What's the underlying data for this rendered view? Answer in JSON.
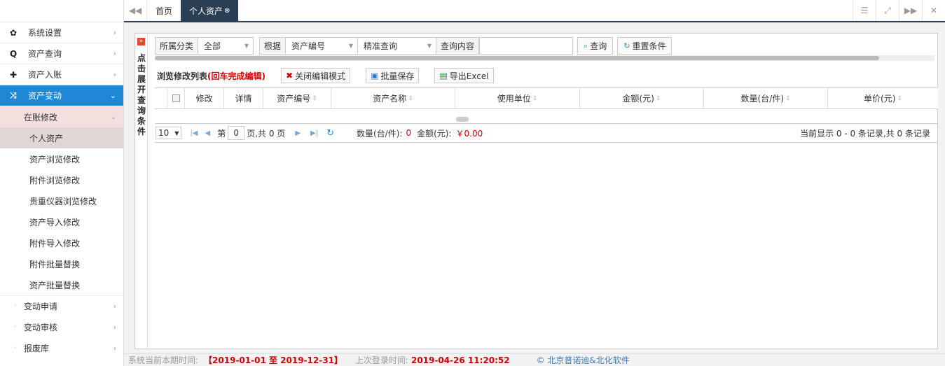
{
  "sidebar": {
    "items": [
      {
        "icon": "gear-icon",
        "glyph": "✿",
        "label": "系统设置"
      },
      {
        "icon": "search-icon",
        "glyph": "🔍︎",
        "label": "资产查询"
      },
      {
        "icon": "plus-icon",
        "glyph": "✚",
        "label": "资产入账"
      },
      {
        "icon": "shuffle-icon",
        "glyph": "⤨",
        "label": "资产变动"
      }
    ],
    "submenu_title": "在账修改",
    "leaves": [
      "个人资产",
      "资产浏览修改",
      "附件浏览修改",
      "贵重仪器浏览修改",
      "资产导入修改",
      "附件导入修改",
      "附件批量替换",
      "资产批量替换"
    ],
    "groups": [
      "变动申请",
      "变动审核",
      "报废库"
    ]
  },
  "tabs": {
    "home": "首页",
    "active": "个人资产"
  },
  "expander": {
    "chars": [
      "点",
      "击",
      "展",
      "开",
      "查",
      "询",
      "条",
      "件"
    ]
  },
  "filter": {
    "category_label": "所属分类",
    "category_value": "全部",
    "basis_label": "根据",
    "field_value": "资产编号",
    "mode_value": "精准查询",
    "content_label": "查询内容",
    "content_value": "",
    "query_btn": "查询",
    "reset_btn": "重置条件"
  },
  "listbar": {
    "title": "浏览修改列表",
    "hint": "(回车完成编辑)",
    "close_edit_btn": "关闭编辑模式",
    "batch_save_btn": "批量保存",
    "export_btn": "导出Excel"
  },
  "grid": {
    "columns": [
      "修改",
      "详情",
      "资产编号",
      "资产名称",
      "使用单位",
      "金额(元)",
      "数量(台/件)",
      "单价(元)"
    ]
  },
  "pager": {
    "page_size": "10",
    "page_prefix": "第",
    "page_value": "0",
    "page_suffix": "页,共 0 页",
    "qty_label": "数量(台/件):",
    "qty_value": "0",
    "amt_label": "金额(元):",
    "amt_value": "￥0.00",
    "summary": "当前显示 0 - 0 条记录,共 0 条记录"
  },
  "footer": {
    "period_label": "系统当前本期时间:",
    "period_value": "【2019-01-01 至 2019-12-31】",
    "login_label": "上次登录时间:",
    "login_value": "2019-04-26 11:20:52",
    "copyright": "© 北京普诺迪&北化软件"
  }
}
